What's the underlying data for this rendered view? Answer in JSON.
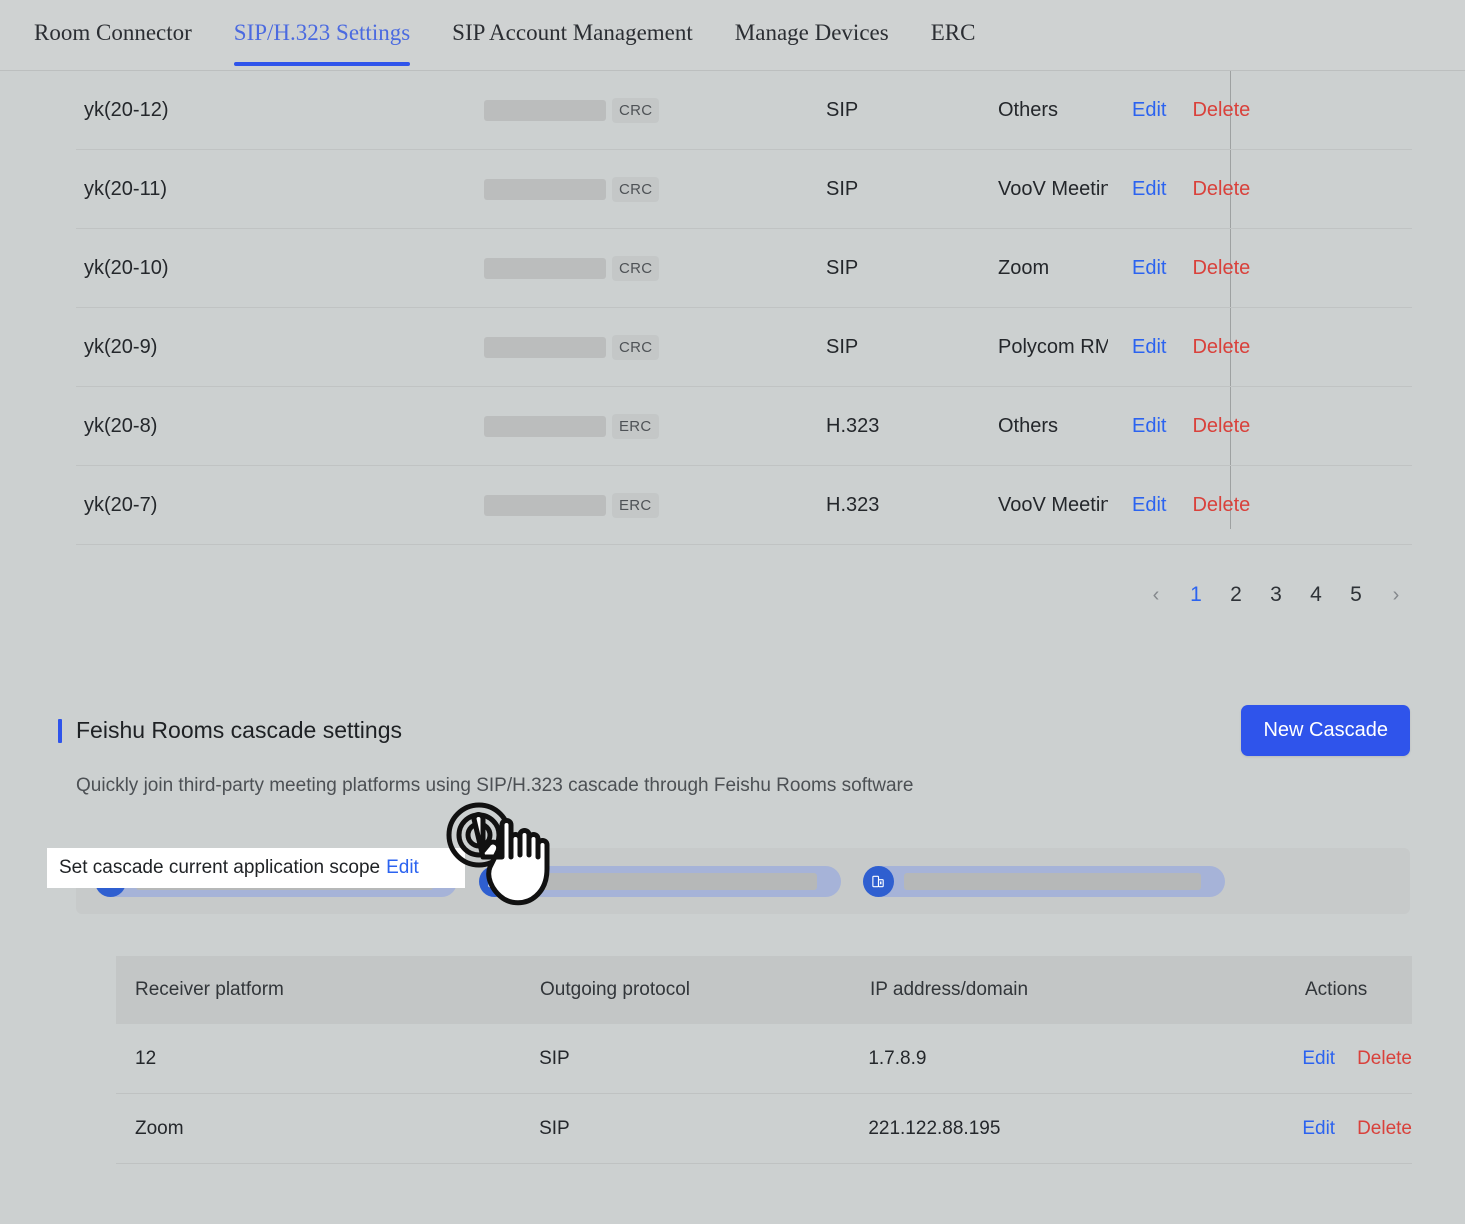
{
  "tabs": [
    {
      "label": "Room Connector",
      "active": false
    },
    {
      "label": "SIP/H.323 Settings",
      "active": true
    },
    {
      "label": "SIP Account Management",
      "active": false
    },
    {
      "label": "Manage Devices",
      "active": false
    },
    {
      "label": "ERC",
      "active": false
    }
  ],
  "device_table": {
    "rows": [
      {
        "name": "yk(20-12)",
        "address": "",
        "tag": "CRC",
        "protocol": "SIP",
        "platform": "Others",
        "edit": "Edit",
        "delete": "Delete"
      },
      {
        "name": "yk(20-11)",
        "address": "",
        "tag": "CRC",
        "protocol": "SIP",
        "platform": "VooV Meeting",
        "edit": "Edit",
        "delete": "Delete"
      },
      {
        "name": "yk(20-10)",
        "address": "",
        "tag": "CRC",
        "protocol": "SIP",
        "platform": "Zoom",
        "edit": "Edit",
        "delete": "Delete"
      },
      {
        "name": "yk(20-9)",
        "address": "",
        "tag": "CRC",
        "protocol": "SIP",
        "platform": "Polycom RMX",
        "edit": "Edit",
        "delete": "Delete"
      },
      {
        "name": "yk(20-8)",
        "address": "",
        "tag": "ERC",
        "protocol": "H.323",
        "platform": "Others",
        "edit": "Edit",
        "delete": "Delete"
      },
      {
        "name": "yk(20-7)",
        "address": "",
        "tag": "ERC",
        "protocol": "H.323",
        "platform": "VooV Meeting",
        "edit": "Edit",
        "delete": "Delete"
      }
    ]
  },
  "pagination": {
    "prev": "‹",
    "next": "›",
    "pages": [
      "1",
      "2",
      "3",
      "4",
      "5"
    ],
    "current": "1"
  },
  "cascade": {
    "title": "Feishu Rooms cascade settings",
    "subtitle": "Quickly join third-party meeting platforms using SIP/H.323 cascade through Feishu Rooms software",
    "new_button": "New Cascade",
    "scope_label": "Set cascade current application scope",
    "scope_edit": "Edit",
    "scope_chips": [
      {
        "icon": "building-icon",
        "label": ""
      },
      {
        "icon": "building-icon",
        "label": ""
      },
      {
        "icon": "building-icon",
        "label": ""
      }
    ]
  },
  "cascade_table": {
    "headers": [
      "Receiver platform",
      "Outgoing protocol",
      "IP address/domain",
      "Actions"
    ],
    "rows": [
      {
        "platform": "12",
        "protocol": "SIP",
        "ip": "1.7.8.9",
        "edit": "Edit",
        "delete": "Delete"
      },
      {
        "platform": "Zoom",
        "protocol": "SIP",
        "ip": "221.122.88.195",
        "edit": "Edit",
        "delete": "Delete"
      }
    ]
  },
  "colors": {
    "accent": "#2f54eb",
    "link": "#2b63f0",
    "danger": "#d9413b",
    "page_bg": "#ccd0d0",
    "chip": "#a6b3d8",
    "chip_icon": "#2f5fd0"
  },
  "cursor": {
    "icon": "pointer-hand-click-icon"
  }
}
